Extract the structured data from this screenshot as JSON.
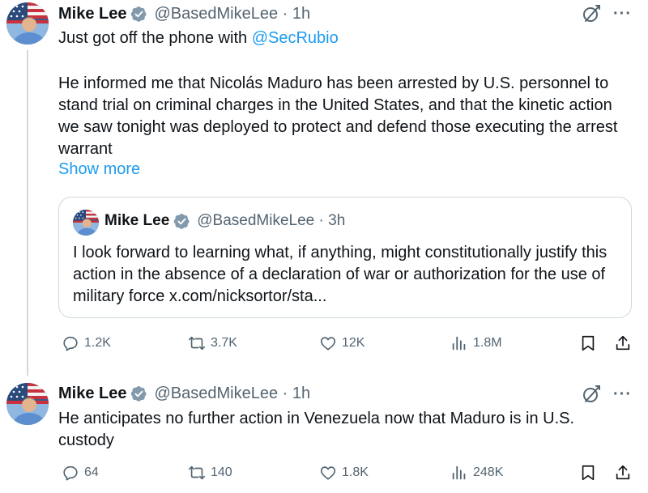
{
  "tweets": [
    {
      "author": {
        "name": "Mike Lee",
        "handle": "@BasedMikeLee",
        "time": "· 1h"
      },
      "text_intro": "Just got off the phone with ",
      "mention": "@SecRubio",
      "paragraph": "He informed me that Nicolás Maduro has been arrested by U.S. personnel to stand trial on criminal charges in the United States, and that the kinetic action we saw tonight was deployed to protect and defend those executing the arrest warrant",
      "show_more": "Show more",
      "quote": {
        "author": {
          "name": "Mike Lee",
          "handle": "@BasedMikeLee",
          "time": "· 3h"
        },
        "text": "I look forward to learning what, if anything, might constitutionally justify this action in the absence of a declaration of war or authorization for the use of military force x.com/nicksortor/sta..."
      },
      "stats": {
        "replies": "1.2K",
        "reposts": "3.7K",
        "likes": "12K",
        "views": "1.8M"
      }
    },
    {
      "author": {
        "name": "Mike Lee",
        "handle": "@BasedMikeLee",
        "time": "· 1h"
      },
      "text": "He anticipates no further action in Venezuela now that Maduro is in U.S. custody",
      "stats": {
        "replies": "64",
        "reposts": "140",
        "likes": "1.8K",
        "views": "248K"
      }
    }
  ],
  "icons": {
    "verified": "verified-badge-icon",
    "grok": "grok-icon",
    "more": "more-icon",
    "reply": "reply-icon",
    "repost": "repost-icon",
    "like": "like-icon",
    "views": "views-icon",
    "bookmark": "bookmark-icon",
    "share": "share-icon"
  },
  "colors": {
    "link": "#1d9bf0",
    "secondary_text": "#536471",
    "border": "#cfd9de",
    "verified": "#829aab"
  }
}
